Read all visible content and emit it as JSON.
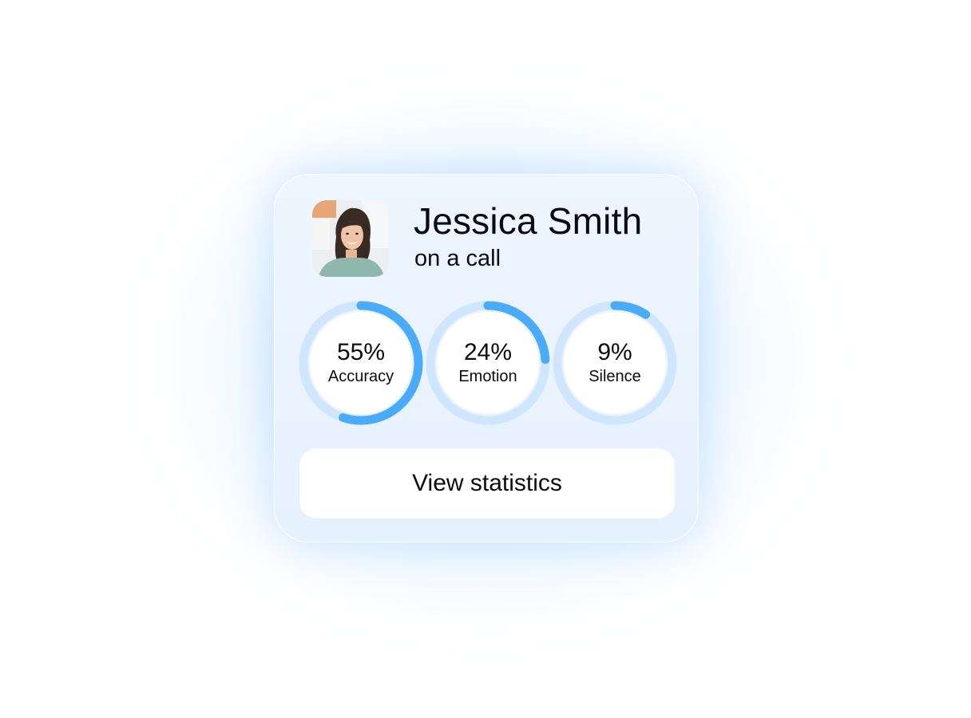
{
  "contact": {
    "name": "Jessica Smith",
    "status": "on a call"
  },
  "metrics": [
    {
      "value": "55%",
      "label": "Accuracy",
      "fraction": 0.55
    },
    {
      "value": "24%",
      "label": "Emotion",
      "fraction": 0.24
    },
    {
      "value": "9%",
      "label": "Silence",
      "fraction": 0.09
    }
  ],
  "actions": {
    "view_statistics_label": "View statistics"
  },
  "colors": {
    "ring_track": "#cfe6fd",
    "ring_progress": "#4aabfa",
    "ring_inner": "#ffffff",
    "accent_glow": "#7fc0ff"
  }
}
